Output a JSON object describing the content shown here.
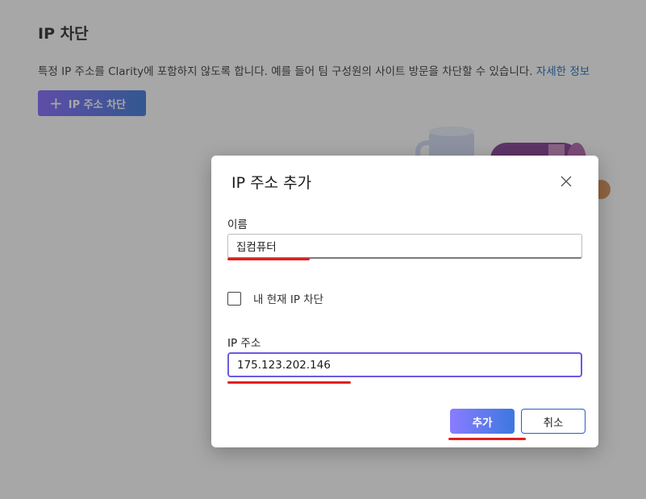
{
  "page": {
    "title": "IP 차단",
    "description": "특정 IP 주소를 Clarity에 포함하지 않도록 합니다. 예를 들어 팀 구성원의 사이트 방문을 차단할 수 있습니다.",
    "learn_more_link": "자세한 정보",
    "block_button_label": "IP 주소 차단",
    "plus_icon": "plus-icon"
  },
  "dialog": {
    "title": "IP 주소 추가",
    "close_icon": "close-icon",
    "name_label": "이름",
    "name_value": "집컴퓨터",
    "block_current_ip_label": "내 현재 IP 차단",
    "block_current_ip_checked": false,
    "ip_label": "IP 주소",
    "ip_value": "175.123.202.146",
    "add_button": "추가",
    "cancel_button": "취소"
  },
  "colors": {
    "accent_start": "#7a5cff",
    "accent_end": "#2d6fd6",
    "link": "#0f5fb8",
    "annotation_red": "#e0201c"
  }
}
